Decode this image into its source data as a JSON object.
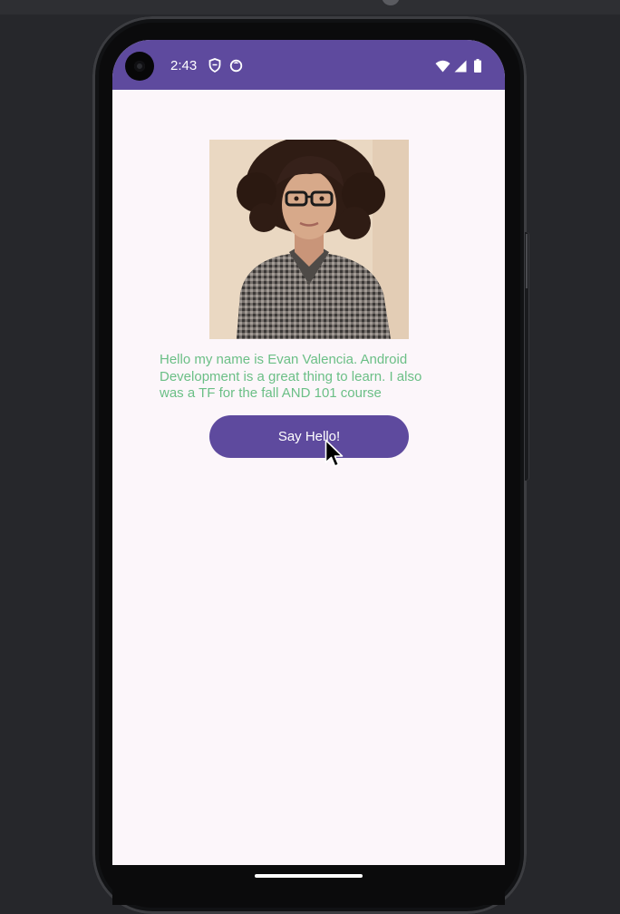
{
  "status_bar": {
    "time": "2:43",
    "icons": [
      "shield-icon",
      "vpn-icon",
      "wifi-icon",
      "signal-icon",
      "battery-icon"
    ],
    "background_color": "#5e4a9e"
  },
  "profile": {
    "photo_alt": "",
    "bio": "Hello my name is Evan Valencia. Android Development is a great thing to learn. I also was a TF for the fall AND 101 course",
    "text_color": "#6bbf86"
  },
  "actions": {
    "say_hello_label": "Say Hello!",
    "button_color": "#5e4a9e"
  },
  "screen_background": "#fcf6fa"
}
